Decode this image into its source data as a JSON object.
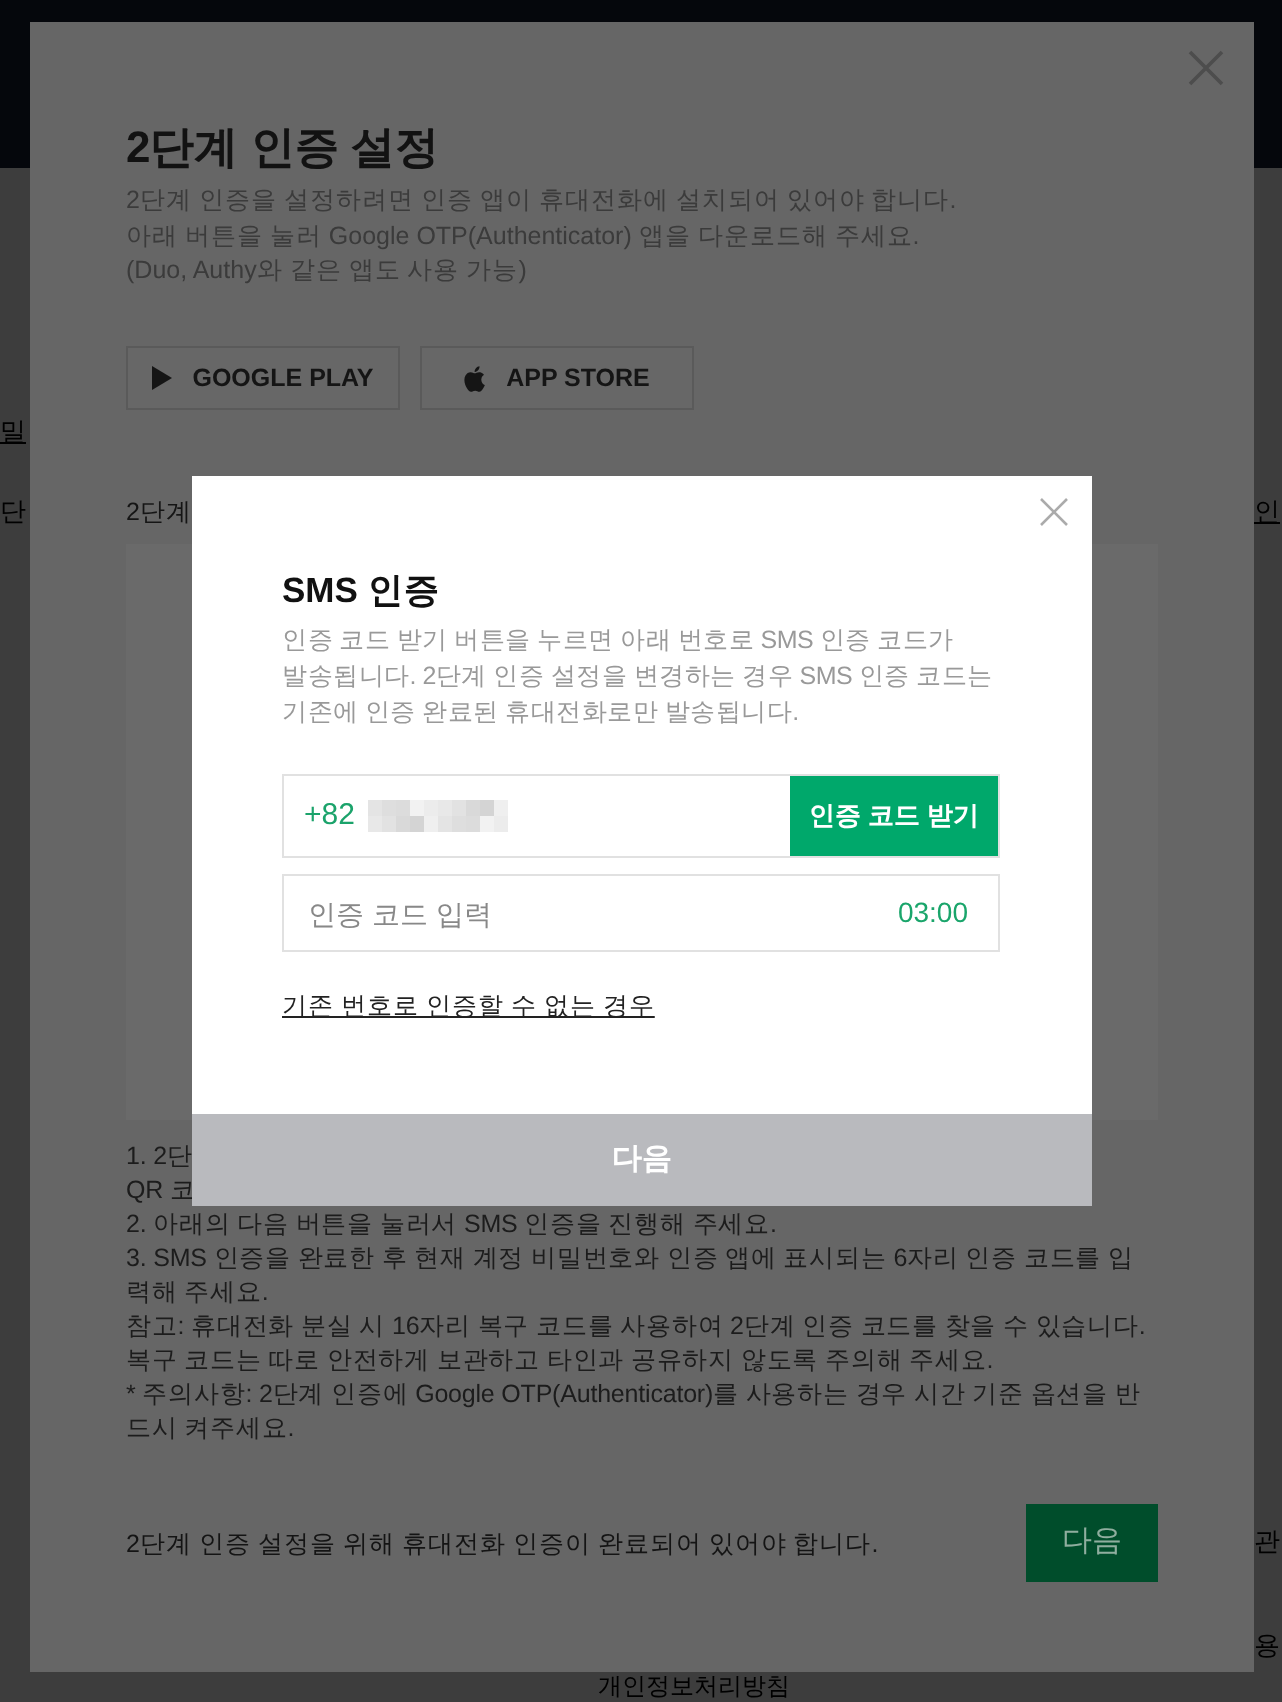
{
  "background_page": {
    "left_fragments": [
      {
        "text": "밀",
        "kind": "link"
      },
      {
        "text": "단",
        "kind": "text"
      }
    ],
    "right_fragments": [
      {
        "text": "인",
        "kind": "link"
      },
      {
        "text": "관",
        "kind": "text"
      },
      {
        "text": "용",
        "kind": "text"
      }
    ],
    "footer_link": "개인정보처리방침"
  },
  "setup_dialog": {
    "title": "2단계 인증 설정",
    "description": "2단계 인증을 설정하려면 인증 앱이 휴대전화에 설치되어 있어야 합니다.\n아래 버튼을 눌러 Google OTP(Authenticator) 앱을 다운로드해 주세요.\n(Duo, Authy와 같은 앱도 사용 가능)",
    "store_buttons": [
      {
        "kind": "play",
        "label": "GOOGLE PLAY"
      },
      {
        "kind": "apple",
        "label": "APP STORE"
      }
    ],
    "section_heading": "2단계",
    "notes": [
      "1. 2단",
      "QR 코",
      "2. 아래의 다음 버튼을 눌러서 SMS 인증을 진행해 주세요.",
      "3. SMS 인증을 완료한 후 현재 계정 비밀번호와 인증 앱에 표시되는 6자리 인증 코드를 입력해 주세요.",
      "참고: 휴대전화 분실 시 16자리 복구 코드를 사용하여 2단계 인증 코드를 찾을 수 있습니다. 복구 코드는 따로 안전하게 보관하고 타인과 공유하지 않도록 주의해 주세요.",
      "* 주의사항: 2단계 인증에 Google OTP(Authenticator)를 사용하는 경우 시간 기준 옵션을 반드시 켜주세요."
    ],
    "footer_text": "2단계 인증 설정을 위해 휴대전화 인증이 완료되어 있어야 합니다.",
    "next_button": {
      "label": "다음",
      "disabled": false
    }
  },
  "sms_dialog": {
    "title": "SMS 인증",
    "description": "인증 코드 받기 버튼을 누르면 아래 번호로 SMS 인증 코드가 발송됩니다. 2단계 인증 설정을 변경하는 경우 SMS 인증 코드는 기존에 인증 완료된 휴대전화로만 발송됩니다.",
    "phone_field": {
      "country_code": "+82"
    },
    "send_button": "인증 코드 받기",
    "code_field": {
      "placeholder": "인증 코드 입력",
      "timer": "03:00"
    },
    "help_link": "기존 번호로 인증할 수 없는 경우",
    "next_button": {
      "label": "다음",
      "disabled": true
    }
  }
}
